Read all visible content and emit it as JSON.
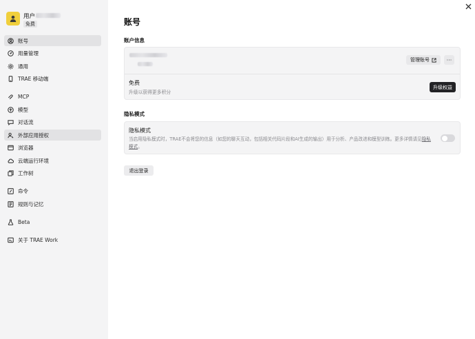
{
  "user": {
    "name_prefix": "用户",
    "plan_badge": "免费"
  },
  "sidebar": {
    "items": [
      {
        "label": "账号",
        "icon": "account-circle-icon"
      },
      {
        "label": "用量管理",
        "icon": "usage-gauge-icon"
      },
      {
        "label": "通用",
        "icon": "gear-icon"
      },
      {
        "label": "TRAE 移动端",
        "icon": "mobile-icon"
      },
      {
        "label": "MCP",
        "icon": "mcp-icon"
      },
      {
        "label": "模型",
        "icon": "model-cube-icon"
      },
      {
        "label": "对话流",
        "icon": "chat-bubble-icon"
      },
      {
        "label": "外部应用授权",
        "icon": "user-key-icon"
      },
      {
        "label": "浏览器",
        "icon": "browser-window-icon"
      },
      {
        "label": "云端运行环境",
        "icon": "cloud-icon"
      },
      {
        "label": "工作树",
        "icon": "worktree-icon"
      },
      {
        "label": "命令",
        "icon": "command-icon"
      },
      {
        "label": "规则与记忆",
        "icon": "book-icon"
      },
      {
        "label": "Beta",
        "icon": "beta-flask-icon"
      },
      {
        "label": "关于 TRAE Work",
        "icon": "info-icon"
      }
    ]
  },
  "main": {
    "title": "账号",
    "account_section": {
      "title": "账户信息",
      "manage_label": "管理账号",
      "more_label": "···",
      "plan_name": "免费",
      "plan_desc": "升级以获得更多积分",
      "upgrade_label": "升级权益"
    },
    "privacy_section": {
      "title": "隐私模式",
      "item_title": "隐私模式",
      "desc_part1": "当启用隐私模式时，TRAE不会将您的信息（如您的聊天互动，包括相关代码片段和AI生成的输出）用于分析、产品改进和模型训练。更多详情请见",
      "link_label": "隐私模式",
      "desc_part2": "。",
      "toggle_on": false
    },
    "logout_label": "退出登录"
  },
  "colors": {
    "avatar": "#f0cf3c",
    "primary_button": "#222225",
    "sidebar_bg": "#f4f4f5"
  }
}
